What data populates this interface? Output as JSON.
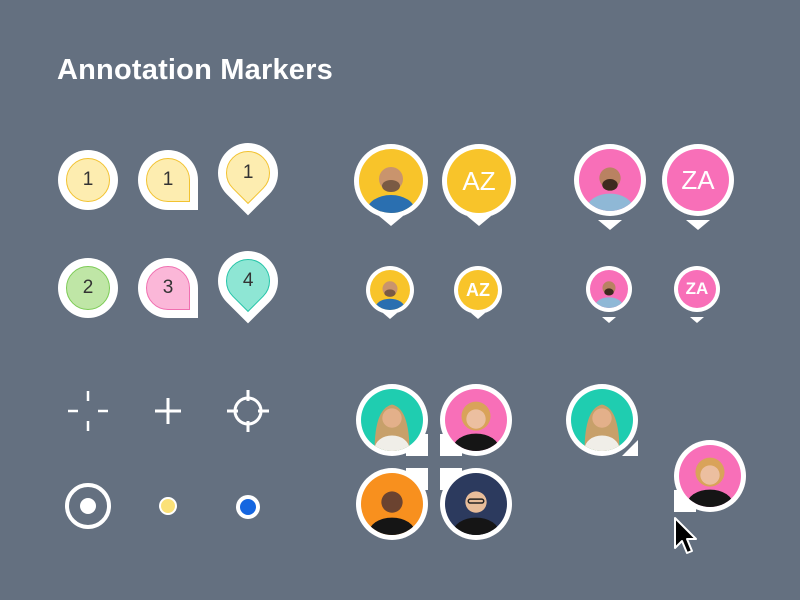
{
  "title": "Annotation Markers",
  "number_markers": [
    {
      "label": "1",
      "shape": "circle",
      "fill": "#fdedb0",
      "stroke": "#f2c230"
    },
    {
      "label": "1",
      "shape": "corner",
      "fill": "#fdedb0",
      "stroke": "#f2c230"
    },
    {
      "label": "1",
      "shape": "pin",
      "fill": "#fdedb0",
      "stroke": "#f2c230"
    },
    {
      "label": "2",
      "shape": "circle",
      "fill": "#bfe6a6",
      "stroke": "#7ccb55"
    },
    {
      "label": "3",
      "shape": "corner",
      "fill": "#fbb7d8",
      "stroke": "#f06fb0"
    },
    {
      "label": "4",
      "shape": "pin",
      "fill": "#8ee6d4",
      "stroke": "#25c4a8"
    }
  ],
  "initials_markers": [
    {
      "label": "AZ",
      "color": "#f8c42a"
    },
    {
      "label": "ZA",
      "color": "#f86fb8"
    },
    {
      "label": "AZ",
      "color": "#f8c42a"
    },
    {
      "label": "ZA",
      "color": "#f86fb8"
    }
  ],
  "avatar_colors": {
    "yellow": "#f8c42a",
    "pink": "#f86fb8",
    "teal": "#1fcdb0",
    "orange": "#f8901e",
    "navy": "#2c3a5e"
  },
  "tool_icons": [
    "crosshair-dashed-icon",
    "plus-icon",
    "target-icon",
    "radio-dot-icon",
    "small-yellow-dot-icon",
    "blue-dot-icon",
    "mouse-cursor-icon"
  ]
}
